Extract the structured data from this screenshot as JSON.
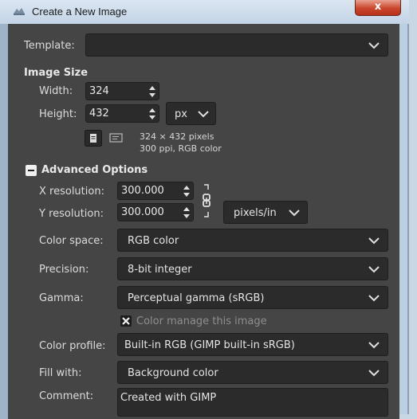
{
  "window": {
    "title": "Create a New Image",
    "close_label": "x"
  },
  "template": {
    "label": "Template:",
    "value": ""
  },
  "image_size": {
    "heading": "Image Size",
    "width_label": "Width:",
    "width_value": "324",
    "height_label": "Height:",
    "height_value": "432",
    "unit": "px",
    "info_line1": "324 × 432 pixels",
    "info_line2": "300 ppi, RGB color"
  },
  "advanced": {
    "heading": "Advanced Options",
    "x_res_label": "X resolution:",
    "x_res_value": "300.000",
    "y_res_label": "Y resolution:",
    "y_res_value": "300.000",
    "res_unit": "pixels/in",
    "color_space_label": "Color space:",
    "color_space_value": "RGB color",
    "precision_label": "Precision:",
    "precision_value": "8-bit integer",
    "gamma_label": "Gamma:",
    "gamma_value": "Perceptual gamma (sRGB)",
    "color_manage_label": "Color manage this image",
    "color_profile_label": "Color profile:",
    "color_profile_value": "Built-in RGB (GIMP built-in sRGB)",
    "fill_label": "Fill with:",
    "fill_value": "Background color",
    "comment_label": "Comment:",
    "comment_value": "Created with GIMP"
  }
}
